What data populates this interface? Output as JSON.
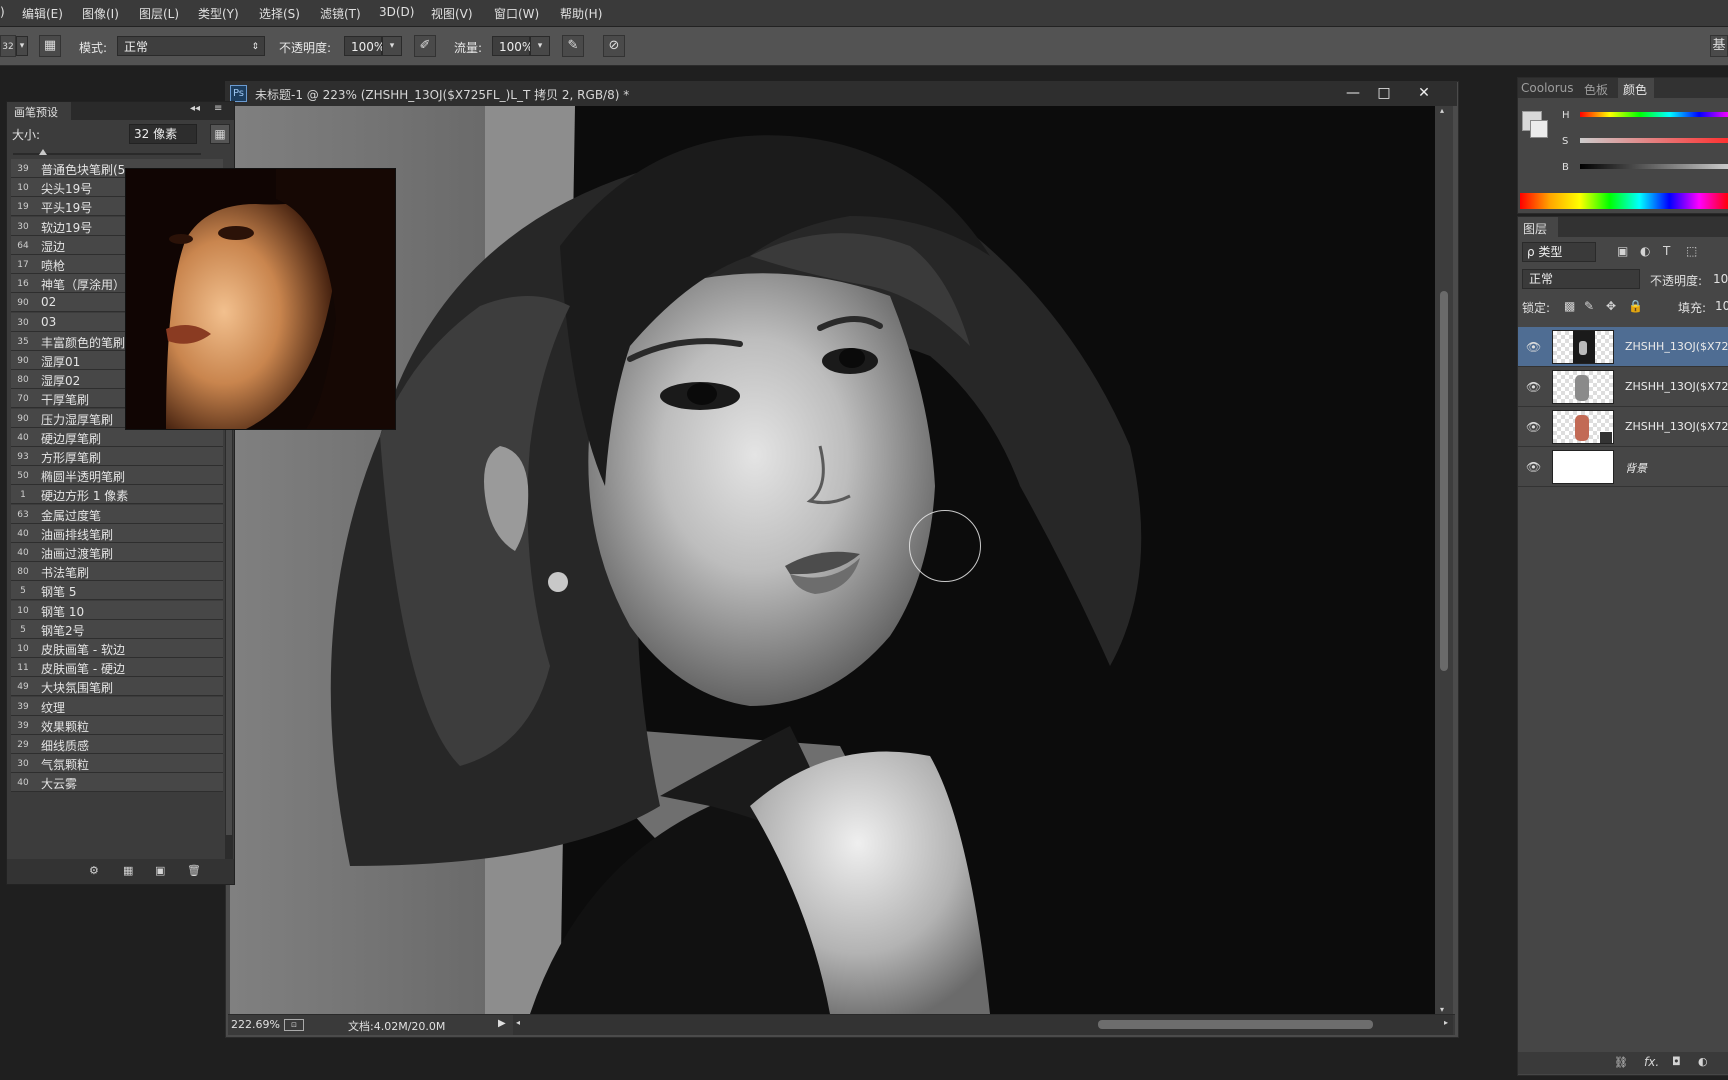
{
  "menu": [
    "编辑(E)",
    "图像(I)",
    "图层(L)",
    "类型(Y)",
    "选择(S)",
    "滤镜(T)",
    "3D(D)",
    "视图(V)",
    "窗口(W)",
    "帮助(H)"
  ],
  "options": {
    "brush_size_value": "32",
    "mode_label": "模式:",
    "mode_value": "正常",
    "opacity_label": "不透明度:",
    "opacity_value": "100%",
    "flow_label": "流量:",
    "flow_value": "100%",
    "right_edge_text": "基"
  },
  "document": {
    "title": "未标题-1 @ 223% (ZHSHH_13OJ($X725FL_)L_T 拷贝 2, RGB/8) *",
    "zoom": "222.69%",
    "doc_size": "文档:4.02M/20.0M",
    "minimize": "—",
    "restore": "□",
    "close": "✕"
  },
  "brush_panel": {
    "title": "画笔预设",
    "size_label": "大小:",
    "size_value": "32 像素",
    "brushes": [
      {
        "size": "39",
        "name": "普通色块笔刷(5"
      },
      {
        "size": "10",
        "name": "尖头19号"
      },
      {
        "size": "19",
        "name": "平头19号"
      },
      {
        "size": "30",
        "name": "软边19号"
      },
      {
        "size": "64",
        "name": "湿边"
      },
      {
        "size": "17",
        "name": "喷枪"
      },
      {
        "size": "16",
        "name": "神笔（厚涂用）"
      },
      {
        "size": "90",
        "name": "02"
      },
      {
        "size": "30",
        "name": "03"
      },
      {
        "size": "35",
        "name": "丰富颜色的笔刷"
      },
      {
        "size": "90",
        "name": "湿厚01"
      },
      {
        "size": "80",
        "name": "湿厚02"
      },
      {
        "size": "70",
        "name": "干厚笔刷"
      },
      {
        "size": "90",
        "name": "压力湿厚笔刷"
      },
      {
        "size": "40",
        "name": "硬边厚笔刷"
      },
      {
        "size": "93",
        "name": "方形厚笔刷"
      },
      {
        "size": "50",
        "name": "椭圆半透明笔刷"
      },
      {
        "size": "1",
        "name": "硬边方形 1 像素"
      },
      {
        "size": "63",
        "name": "金属过度笔"
      },
      {
        "size": "40",
        "name": "油画排线笔刷"
      },
      {
        "size": "40",
        "name": "油画过渡笔刷"
      },
      {
        "size": "80",
        "name": "书法笔刷"
      },
      {
        "size": "5",
        "name": "钢笔 5"
      },
      {
        "size": "10",
        "name": "钢笔 10"
      },
      {
        "size": "5",
        "name": "钢笔2号"
      },
      {
        "size": "10",
        "name": "皮肤画笔 - 软边"
      },
      {
        "size": "11",
        "name": "皮肤画笔 - 硬边"
      },
      {
        "size": "49",
        "name": "大块氛围笔刷"
      },
      {
        "size": "39",
        "name": "纹理"
      },
      {
        "size": "39",
        "name": "效果颗粒"
      },
      {
        "size": "29",
        "name": "细线质感"
      },
      {
        "size": "30",
        "name": "气氛颗粒"
      },
      {
        "size": "40",
        "name": "大云雾"
      }
    ]
  },
  "color_panel": {
    "tabs": [
      "Coolorus",
      "色板",
      "颜色"
    ],
    "active_tab": "颜色",
    "h_label": "H",
    "s_label": "S",
    "b_label": "B"
  },
  "layers_panel": {
    "title": "图层",
    "filter_label": "ρ 类型",
    "blend_mode": "正常",
    "opacity_label": "不透明度:",
    "opacity_value": "10",
    "lock_label": "锁定:",
    "fill_label": "填充:",
    "fill_value": "10",
    "layers": [
      {
        "name": "ZHSHH_13OJ($X72",
        "selected": true
      },
      {
        "name": "ZHSHH_13OJ($X72",
        "selected": false
      },
      {
        "name": "ZHSHH_13OJ($X72",
        "selected": false
      },
      {
        "name": "背景",
        "selected": false
      }
    ]
  },
  "colors": {
    "selection": "#4f6d93",
    "panel": "#464646",
    "canvas_dark": "#0d0d0d"
  }
}
